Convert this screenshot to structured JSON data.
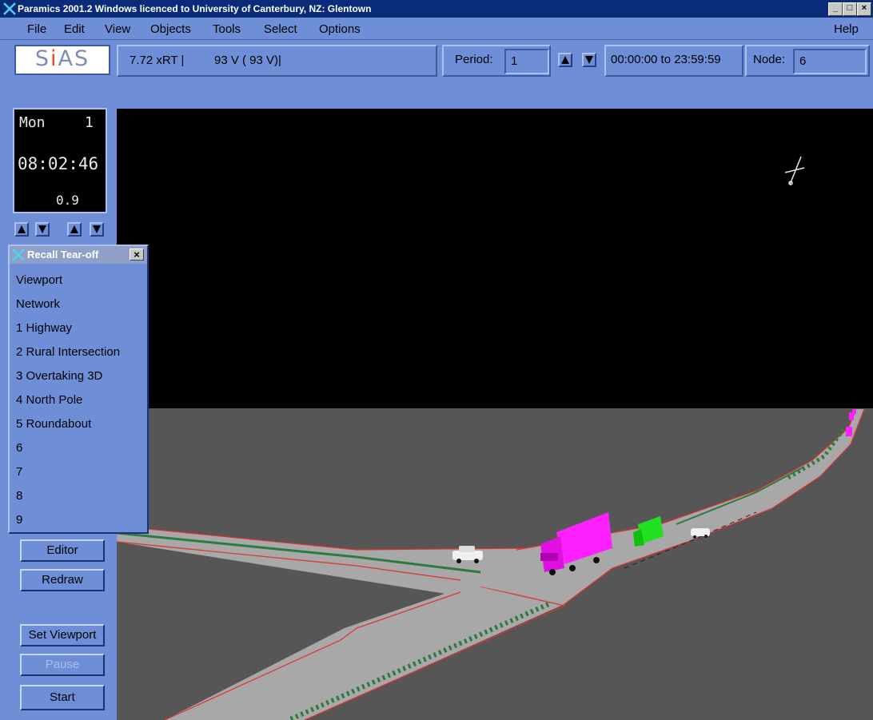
{
  "window": {
    "title": "Paramics 2001.2 Windows licenced to University of Canterbury, NZ: Glentown",
    "minimize": "_",
    "maximize": "□",
    "close": "×"
  },
  "menu": {
    "file": "File",
    "edit": "Edit",
    "view": "View",
    "objects": "Objects",
    "tools": "Tools",
    "select": "Select",
    "options": "Options",
    "help": "Help"
  },
  "toolbar": {
    "logo": "SiAS",
    "speed": "7.72 xRT |",
    "vehicles": "93 V (   93 V)|",
    "period_label": "Period:",
    "period_value": "1",
    "time_range": "00:00:00 to 23:59:59",
    "node_label": "Node:",
    "node_value": "6"
  },
  "clock": {
    "day": "Mon",
    "day_number": "1",
    "time": "08:02:46",
    "value": "0.9"
  },
  "recall": {
    "title": "Recall Tear-off",
    "items": [
      "Viewport",
      "Network",
      "1 Highway",
      "2 Rural Intersection",
      "3 Overtaking 3D",
      "4 North Pole",
      "5 Roundabout",
      "6",
      "7",
      "8",
      "9"
    ]
  },
  "buttons": {
    "editor": "Editor",
    "redraw": "Redraw",
    "set_viewport": "Set Viewport",
    "pause": "Pause",
    "start": "Start"
  },
  "colors": {
    "ui_blue": "#6e8fd8",
    "title_bar": "#0a2a7a",
    "road": "#a8a8a8",
    "ground": "#565656",
    "truck": "#ff20ff",
    "green_vehicle": "#20e020",
    "lane_marking": "#2e7a3e",
    "road_edge": "#e03030"
  }
}
